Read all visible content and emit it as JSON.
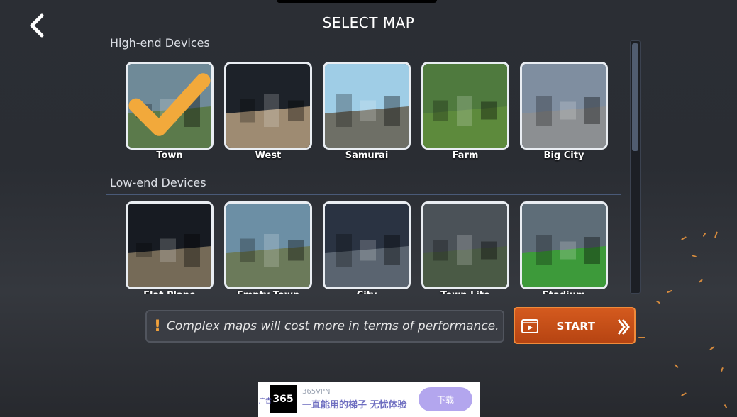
{
  "header": {
    "title": "SELECT MAP"
  },
  "sections": [
    {
      "title": "High-end Devices",
      "maps": [
        {
          "label": "Town",
          "selected": true,
          "sky": "#6f8a98",
          "ground": "#5b7a4b"
        },
        {
          "label": "West",
          "selected": false,
          "sky": "#1d2229",
          "ground": "#9e8b72"
        },
        {
          "label": "Samurai",
          "selected": false,
          "sky": "#9fcde6",
          "ground": "#6e6f66"
        },
        {
          "label": "Farm",
          "selected": false,
          "sky": "#4f7a3e",
          "ground": "#5d8a3c"
        },
        {
          "label": "Big City",
          "selected": false,
          "sky": "#7f8ea0",
          "ground": "#8c8f92"
        }
      ]
    },
    {
      "title": "Low-end Devices",
      "maps": [
        {
          "label": "Flat Plane",
          "selected": false,
          "sky": "#171b22",
          "ground": "#756a57"
        },
        {
          "label": "Empty Town",
          "selected": false,
          "sky": "#6c8fa5",
          "ground": "#6b7a5a"
        },
        {
          "label": "City",
          "selected": false,
          "sky": "#2a3342",
          "ground": "#5a6470"
        },
        {
          "label": "Town Lite",
          "selected": false,
          "sky": "#4b5258",
          "ground": "#4a5a45"
        },
        {
          "label": "Stadium",
          "selected": false,
          "sky": "#5e6d78",
          "ground": "#3d9a3a"
        }
      ]
    }
  ],
  "warning": {
    "icon": "!",
    "text": "Complex maps will cost more in terms of performance."
  },
  "start": {
    "label": "START"
  },
  "ad": {
    "logo": "365",
    "tag": "广告",
    "subtitle": "365VPN",
    "headline": "一直能用的梯子 无忧体验",
    "button": "下载"
  },
  "colors": {
    "accent": "#d45a1e",
    "warning": "#f1a13b",
    "divider": "#4a5a78"
  }
}
